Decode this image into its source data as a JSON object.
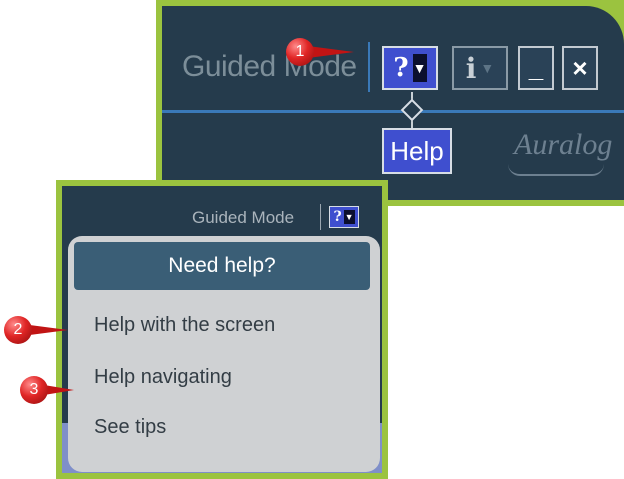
{
  "top_toolbar": {
    "title": "Guided Mode",
    "help_button": {
      "glyph": "?",
      "arrow": "▼"
    },
    "info_button": {
      "glyph": "i",
      "arrow": "▼"
    },
    "minimize_glyph": "_",
    "close_glyph": "×",
    "help_tooltip": "Help",
    "logo_text": "Auralog"
  },
  "small_toolbar": {
    "title": "Guided Mode",
    "help_button": {
      "glyph": "?",
      "arrow": "▼"
    }
  },
  "help_menu": {
    "header": "Need help?",
    "items": [
      "Help with the screen",
      "Help navigating",
      "See tips"
    ]
  },
  "callouts": [
    "1",
    "2",
    "3"
  ],
  "colors": {
    "panel_border": "#9bc33f",
    "toolbar_bg": "#253b4c",
    "help_button": "#3f4fcf",
    "menu_bg": "#cfd1d3",
    "menu_header": "#3a5e76",
    "callout": "#e02525"
  }
}
